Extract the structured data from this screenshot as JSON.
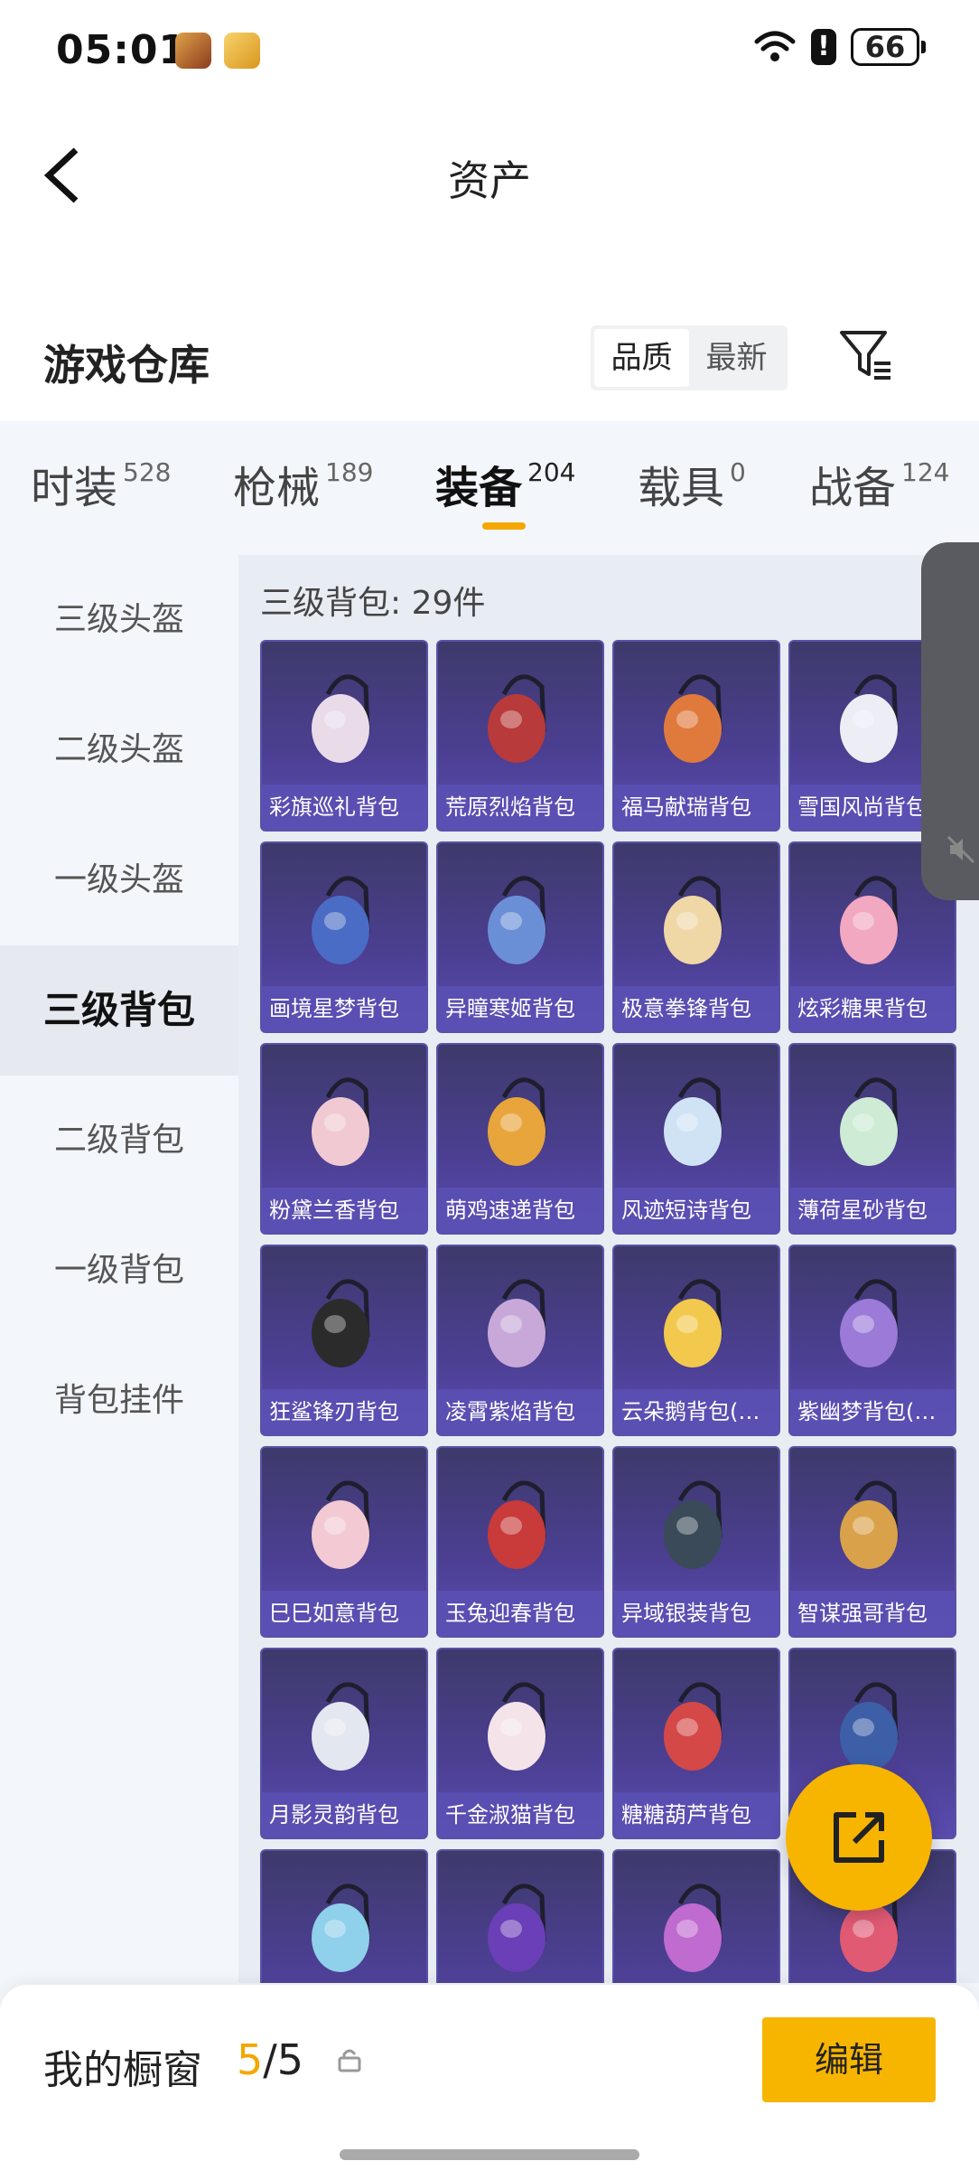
{
  "status_bar": {
    "time": "05:01",
    "battery": "66",
    "alert": "!"
  },
  "header": {
    "title": "资产"
  },
  "section": {
    "title": "游戏仓库",
    "sort_options": [
      "品质",
      "最新"
    ],
    "active_sort": "品质"
  },
  "tabs": [
    {
      "label": "时装",
      "count": "528"
    },
    {
      "label": "枪械",
      "count": "189"
    },
    {
      "label": "装备",
      "count": "204"
    },
    {
      "label": "载具",
      "count": "0"
    },
    {
      "label": "战备",
      "count": "124"
    }
  ],
  "categories": [
    "三级头盔",
    "二级头盔",
    "一级头盔",
    "三级背包",
    "二级背包",
    "一级背包",
    "背包挂件"
  ],
  "active_category": "三级背包",
  "content": {
    "title": "三级背包: 29件",
    "items": [
      "彩旗巡礼背包",
      "荒原烈焰背包",
      "福马献瑞背包",
      "雪国风尚背包",
      "画境星梦背包",
      "异瞳寒姬背包",
      "极意拳锋背包",
      "炫彩糖果背包",
      "粉黛兰香背包",
      "萌鸡速递背包",
      "风迹短诗背包",
      "薄荷星砂背包",
      "狂鲨锋刃背包",
      "凌霄紫焰背包",
      "云朵鹅背包(…",
      "紫幽梦背包(…",
      "巳巳如意背包",
      "玉兔迎春背包",
      "异域银装背包",
      "智谋强哥背包",
      "月影灵韵背包",
      "千金淑猫背包",
      "糖糖葫芦背包",
      "",
      "",
      "",
      "",
      ""
    ],
    "item_colors": [
      "#e9dbe8",
      "#b83a3a",
      "#e07a3c",
      "#ecedf5",
      "#4a6cc5",
      "#6b8fd6",
      "#f0d7a6",
      "#f2a8c0",
      "#f0c9d2",
      "#e8a53c",
      "#cfe3f5",
      "#cdebd5",
      "#2b2b2b",
      "#c7a8d8",
      "#f2c94c",
      "#9b7ad8",
      "#f3c9d4",
      "#c93a3a",
      "#3a4a58",
      "#d9a24a",
      "#e3e7f0",
      "#f5e3ea",
      "#d54848",
      "#3d5fa8",
      "#8fd0ea",
      "#6a3fb8",
      "#c06bd0",
      "#e05a74"
    ]
  },
  "bottom": {
    "label": "我的橱窗",
    "current": "5",
    "total": "/5",
    "edit_label": "编辑"
  }
}
